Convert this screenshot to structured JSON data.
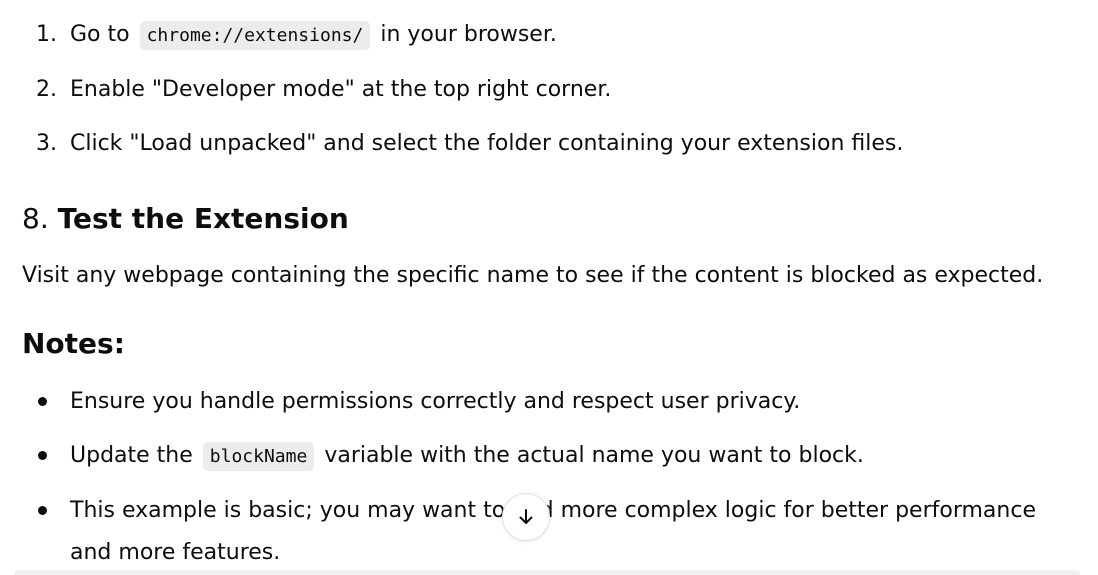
{
  "steps": [
    {
      "num": "1.",
      "pre": "Go to",
      "code": "chrome://extensions/",
      "post": "in your browser."
    },
    {
      "num": "2.",
      "text": "Enable \"Developer mode\" at the top right corner."
    },
    {
      "num": "3.",
      "text": "Click \"Load unpacked\" and select the folder containing your extension files."
    }
  ],
  "section8": {
    "num": "8.",
    "title": "Test the Extension",
    "text": "Visit any webpage containing the specific name to see if the content is blocked as expected."
  },
  "notes": {
    "title": "Notes:",
    "items": [
      {
        "text": "Ensure you handle permissions correctly and respect user privacy."
      },
      {
        "pre": "Update the",
        "code": "blockName",
        "post": "variable with the actual name you want to block."
      },
      {
        "text": "This example is basic; you may want to add more complex logic for better performance and more features."
      }
    ]
  },
  "scroll_button": {
    "icon": "arrow-down-icon"
  }
}
